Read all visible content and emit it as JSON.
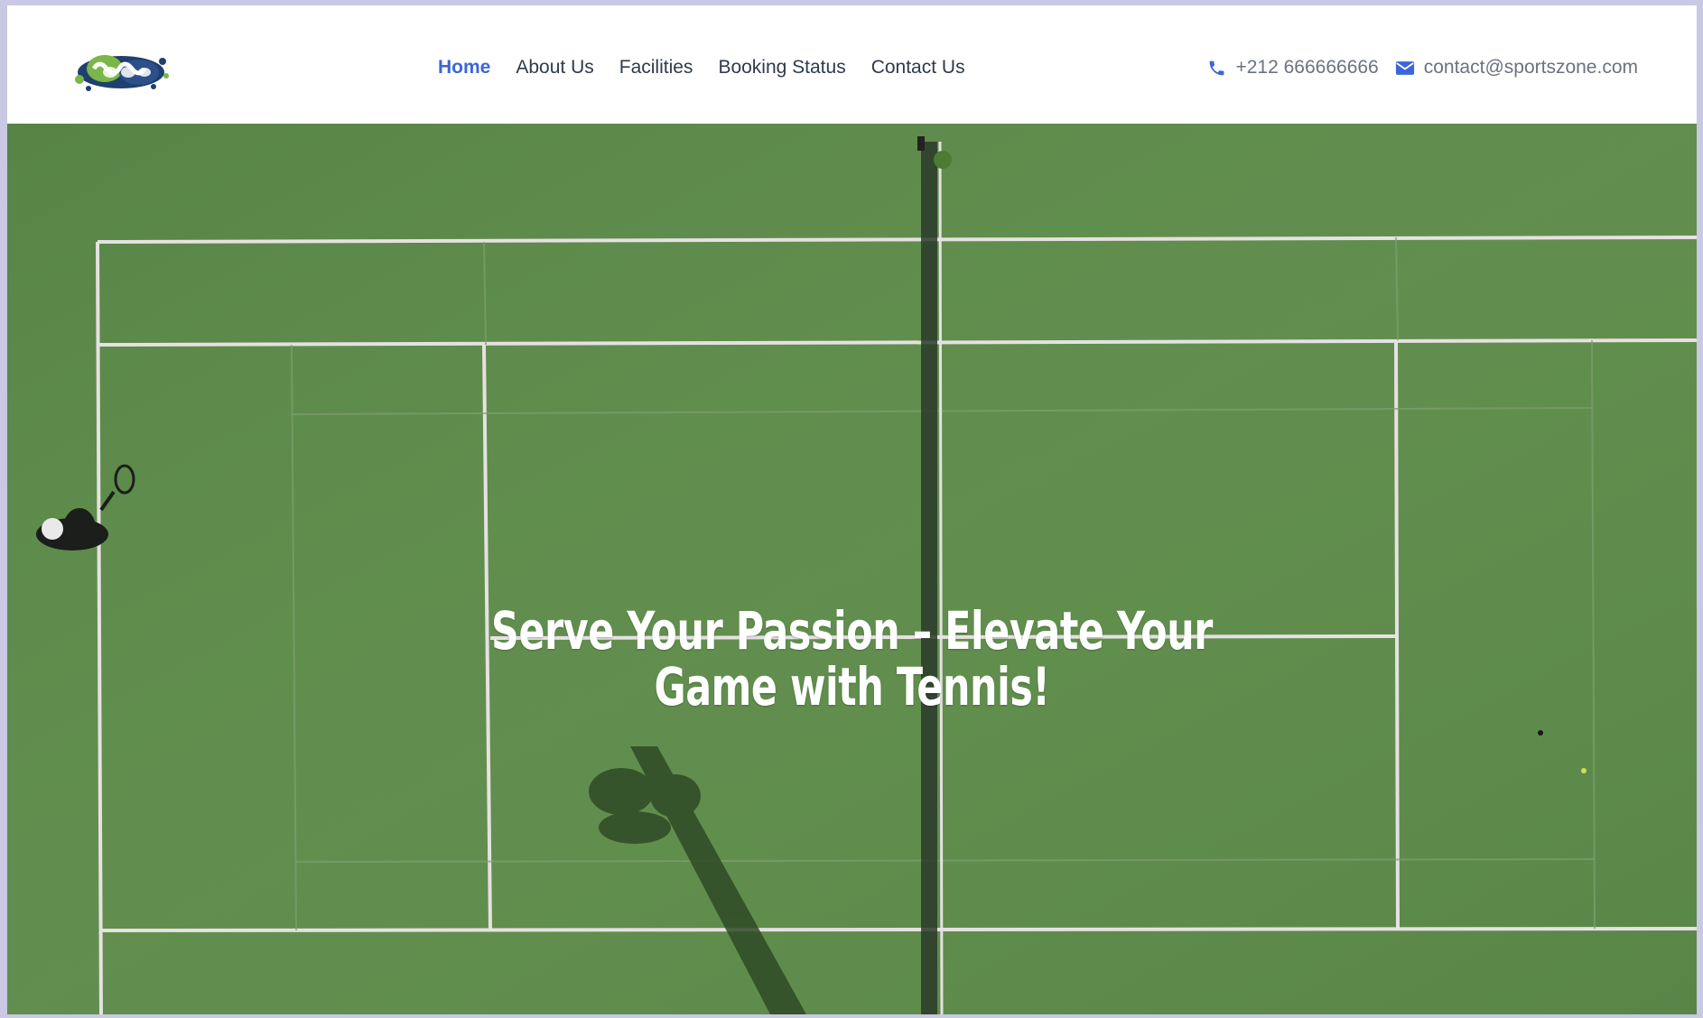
{
  "header": {
    "logo_icon": "sportszone-splash-logo",
    "nav": [
      {
        "label": "Home",
        "active": true
      },
      {
        "label": "About Us",
        "active": false
      },
      {
        "label": "Facilities",
        "active": false
      },
      {
        "label": "Booking Status",
        "active": false
      },
      {
        "label": "Contact Us",
        "active": false
      }
    ],
    "phone_icon": "phone-icon",
    "phone": "+212 666666666",
    "email_icon": "envelope-icon",
    "email": "contact@sportszone.com"
  },
  "hero": {
    "background": "aerial-tennis-court-photo",
    "title": "Serve Your Passion – Elevate Your Game with Tennis!"
  },
  "colors": {
    "accent": "#3a67d4",
    "nav_text": "#2f3a4b",
    "contact_text": "#6b7280",
    "court_green": "#5f8c4c",
    "frame": "#c9c9e3"
  }
}
